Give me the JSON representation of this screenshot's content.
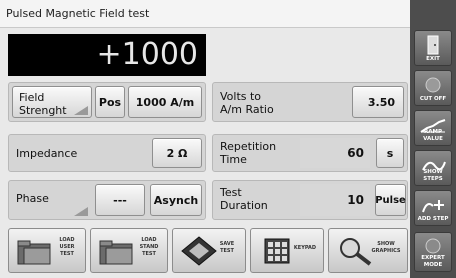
{
  "window": {
    "title": "Pulsed Magnetic Field test"
  },
  "display": {
    "value": "+1000"
  },
  "field": {
    "label_line1": "Field",
    "label_line2": "Strenght",
    "polarity": "Pos",
    "value": "1000 A/m"
  },
  "volts_ratio": {
    "label_line1": "Volts to",
    "label_line2": "A/m Ratio",
    "value": "3.50"
  },
  "impedance": {
    "label": "Impedance",
    "value": "2 Ω"
  },
  "repetition": {
    "label_line1": "Repetition",
    "label_line2": "Time",
    "value": "60",
    "unit": "s"
  },
  "phase": {
    "label": "Phase",
    "value": "---",
    "mode": "Asynch"
  },
  "test_duration": {
    "label_line1": "Test",
    "label_line2": "Duration",
    "value": "10",
    "unit": "Pulse"
  },
  "toolbar": {
    "load_user": {
      "l1": "LOAD",
      "l2": "USER",
      "l3": "TEST"
    },
    "load_stand": {
      "l1": "LOAD",
      "l2": "STAND",
      "l3": "TEST"
    },
    "save": {
      "l1": "SAVE",
      "l2": "TEST"
    },
    "keypad": {
      "l1": "KEYPAD"
    },
    "show_graphics": {
      "l1": "SHOW",
      "l2": "GRAPHICS"
    }
  },
  "sidebar": {
    "exit": "EXIT",
    "cut_off": "CUT OFF",
    "ramp_value": "RAMP VALUE",
    "show_steps": "SHOW STEPS",
    "add_step": "ADD STEP",
    "expert_mode_1": "EXPERT",
    "expert_mode_2": "MODE"
  },
  "colors": {
    "display_bg": "#000000",
    "sidebar_bg": "#4d4d4d",
    "panel_bg": "#d5d5d5"
  }
}
